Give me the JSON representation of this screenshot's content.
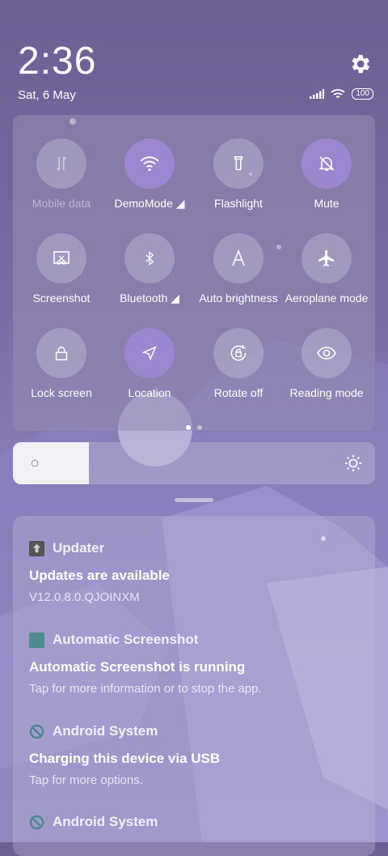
{
  "status_bar": {
    "time": "2:36",
    "date": "Sat, 6 May",
    "battery": "100"
  },
  "quick_settings": {
    "tiles": [
      {
        "label": "Mobile data",
        "icon": "mobile-data-icon",
        "active": false,
        "disabled": true
      },
      {
        "label": "DemoMode ◢",
        "icon": "wifi-icon",
        "active": true,
        "disabled": false
      },
      {
        "label": "Flashlight",
        "icon": "flashlight-icon",
        "active": false,
        "disabled": false
      },
      {
        "label": "Mute",
        "icon": "mute-bell-icon",
        "active": true,
        "disabled": false
      },
      {
        "label": "Screenshot",
        "icon": "screenshot-icon",
        "active": false,
        "disabled": false
      },
      {
        "label": "Bluetooth ◢",
        "icon": "bluetooth-icon",
        "active": false,
        "disabled": false
      },
      {
        "label": "Auto brightness",
        "icon": "auto-brightness-icon",
        "active": false,
        "disabled": false
      },
      {
        "label": "Aeroplane mode",
        "icon": "aeroplane-icon",
        "active": false,
        "disabled": false
      },
      {
        "label": "Lock screen",
        "icon": "lock-icon",
        "active": false,
        "disabled": false
      },
      {
        "label": "Location",
        "icon": "location-icon",
        "active": true,
        "disabled": false
      },
      {
        "label": "Rotate off",
        "icon": "rotate-lock-icon",
        "active": false,
        "disabled": false
      },
      {
        "label": "Reading mode",
        "icon": "eye-icon",
        "active": false,
        "disabled": false
      }
    ],
    "page_count": 2,
    "current_page": 1
  },
  "brightness": {
    "level": 0.21
  },
  "notifications": [
    {
      "app": "Updater",
      "title": "Updates are available",
      "body": "V12.0.8.0.QJOINXM",
      "icon": "updater-icon"
    },
    {
      "app": "Automatic Screenshot",
      "title": "Automatic Screenshot is running",
      "body": "Tap for more information or to stop the app.",
      "icon": "app-square-icon"
    },
    {
      "app": "Android System",
      "title": "Charging this device via USB",
      "body": "Tap for more options.",
      "icon": "android-system-icon"
    },
    {
      "app": "Android System",
      "title": "",
      "body": "",
      "icon": "android-system-icon"
    }
  ],
  "colors": {
    "active_tile": "#9b86cf",
    "background": "#7a6ba3"
  }
}
